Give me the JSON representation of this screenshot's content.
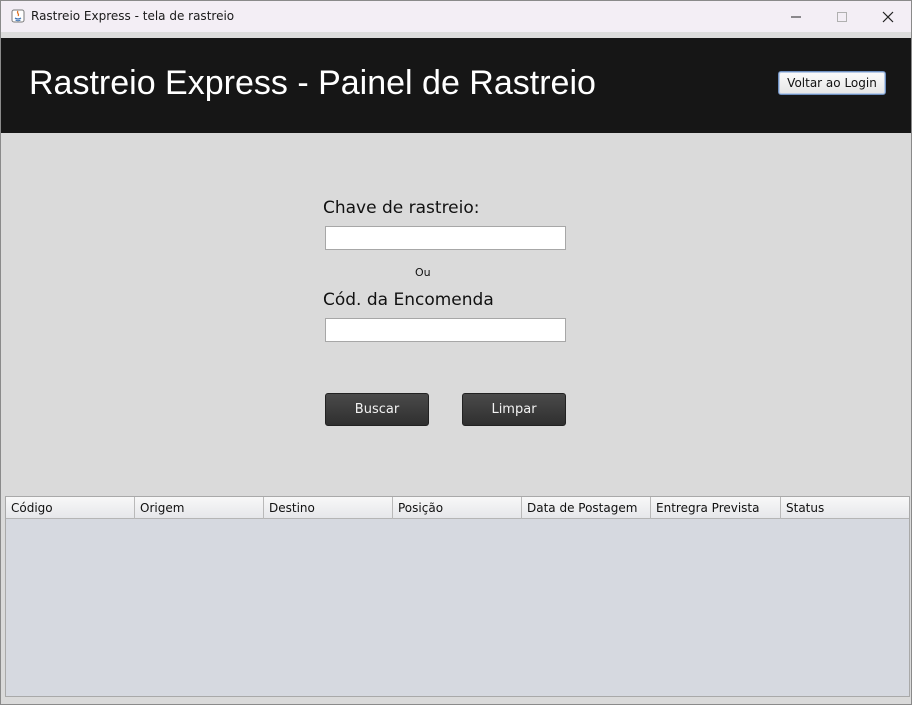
{
  "window": {
    "title": "Rastreio Express - tela de rastreio"
  },
  "header": {
    "title": "Rastreio Express - Painel de Rastreio",
    "back_label": "Voltar ao Login"
  },
  "form": {
    "tracking_key_label": "Chave de rastreio:",
    "tracking_key_value": "",
    "or_label": "Ou",
    "order_code_label": "Cód. da Encomenda",
    "order_code_value": "",
    "search_label": "Buscar",
    "clear_label": "Limpar"
  },
  "table": {
    "columns": [
      "Código",
      "Origem",
      "Destino",
      "Posição",
      "Data de Postagem",
      "Entregra Prevista",
      "Status"
    ],
    "rows": []
  },
  "colors": {
    "header_bg": "#161616",
    "window_bg": "#dadada",
    "button_dark": "#3a3a3a",
    "table_bg": "#d6d9e0"
  }
}
